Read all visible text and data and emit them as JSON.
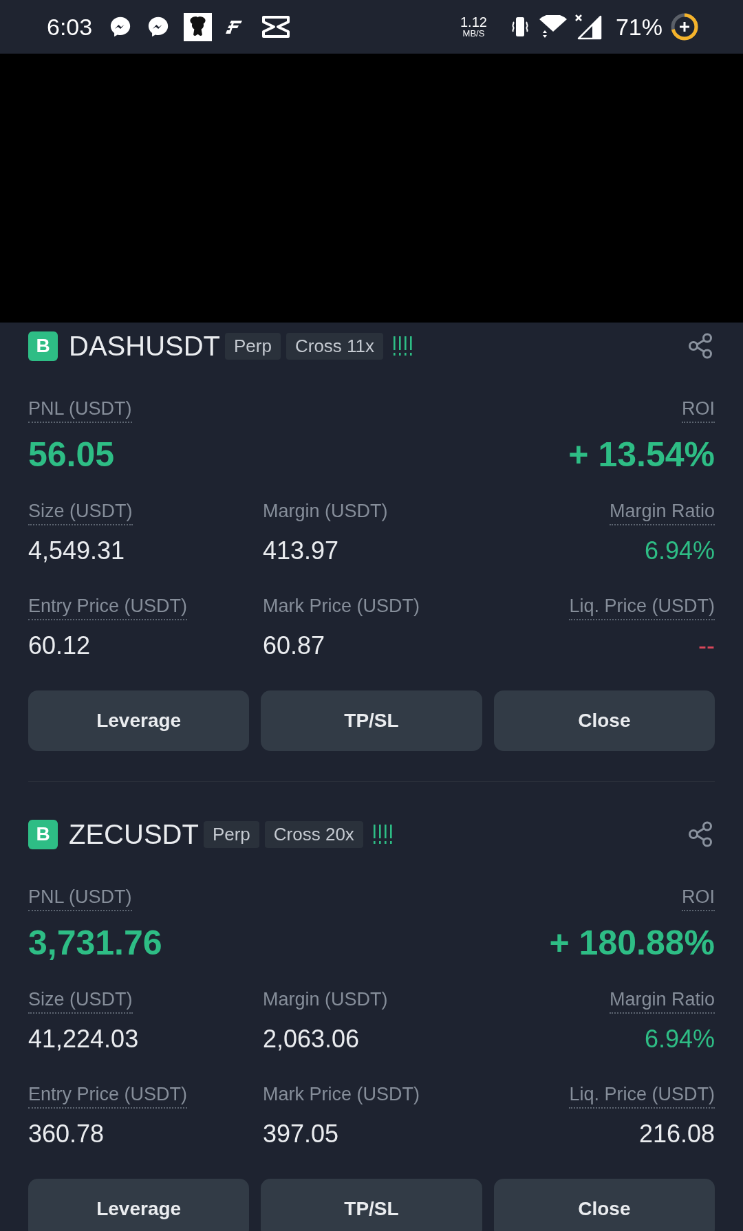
{
  "status_bar": {
    "time": "6:03",
    "network_speed": "1.12",
    "network_speed_unit": "MB/S",
    "battery": "71%"
  },
  "positions": [
    {
      "badge": "B",
      "symbol": "DASHUSDT",
      "tags": [
        "Perp",
        "Cross 11x"
      ],
      "pnl": {
        "label": "PNL (USDT)",
        "value": "56.05",
        "color": "#2ebd85"
      },
      "roi": {
        "label": "ROI",
        "value": "+ 13.54%",
        "color": "#2ebd85"
      },
      "fields": [
        {
          "label": "Size (USDT)",
          "underlined": true,
          "value": "4,549.31",
          "color": "#eaecef"
        },
        {
          "label": "Margin (USDT)",
          "underlined": false,
          "value": "413.97",
          "color": "#eaecef"
        },
        {
          "label": "Margin Ratio",
          "underlined": true,
          "value": "6.94%",
          "color": "#2ebd85"
        },
        {
          "label": "Entry Price (USDT)",
          "underlined": true,
          "value": "60.12",
          "color": "#eaecef"
        },
        {
          "label": "Mark Price (USDT)",
          "underlined": false,
          "value": "60.87",
          "color": "#eaecef"
        },
        {
          "label": "Liq. Price (USDT)",
          "underlined": true,
          "value": "--",
          "color": "#d9475a"
        }
      ],
      "buttons": [
        "Leverage",
        "TP/SL",
        "Close"
      ]
    },
    {
      "badge": "B",
      "symbol": "ZECUSDT",
      "tags": [
        "Perp",
        "Cross 20x"
      ],
      "pnl": {
        "label": "PNL (USDT)",
        "value": "3,731.76",
        "color": "#2ebd85"
      },
      "roi": {
        "label": "ROI",
        "value": "+ 180.88%",
        "color": "#2ebd85"
      },
      "fields": [
        {
          "label": "Size (USDT)",
          "underlined": true,
          "value": "41,224.03",
          "color": "#eaecef"
        },
        {
          "label": "Margin (USDT)",
          "underlined": false,
          "value": "2,063.06",
          "color": "#eaecef"
        },
        {
          "label": "Margin Ratio",
          "underlined": true,
          "value": "6.94%",
          "color": "#2ebd85"
        },
        {
          "label": "Entry Price (USDT)",
          "underlined": true,
          "value": "360.78",
          "color": "#eaecef"
        },
        {
          "label": "Mark Price (USDT)",
          "underlined": false,
          "value": "397.05",
          "color": "#eaecef"
        },
        {
          "label": "Liq. Price (USDT)",
          "underlined": true,
          "value": "216.08",
          "color": "#eaecef"
        }
      ],
      "buttons": [
        "Leverage",
        "TP/SL",
        "Close"
      ]
    }
  ]
}
